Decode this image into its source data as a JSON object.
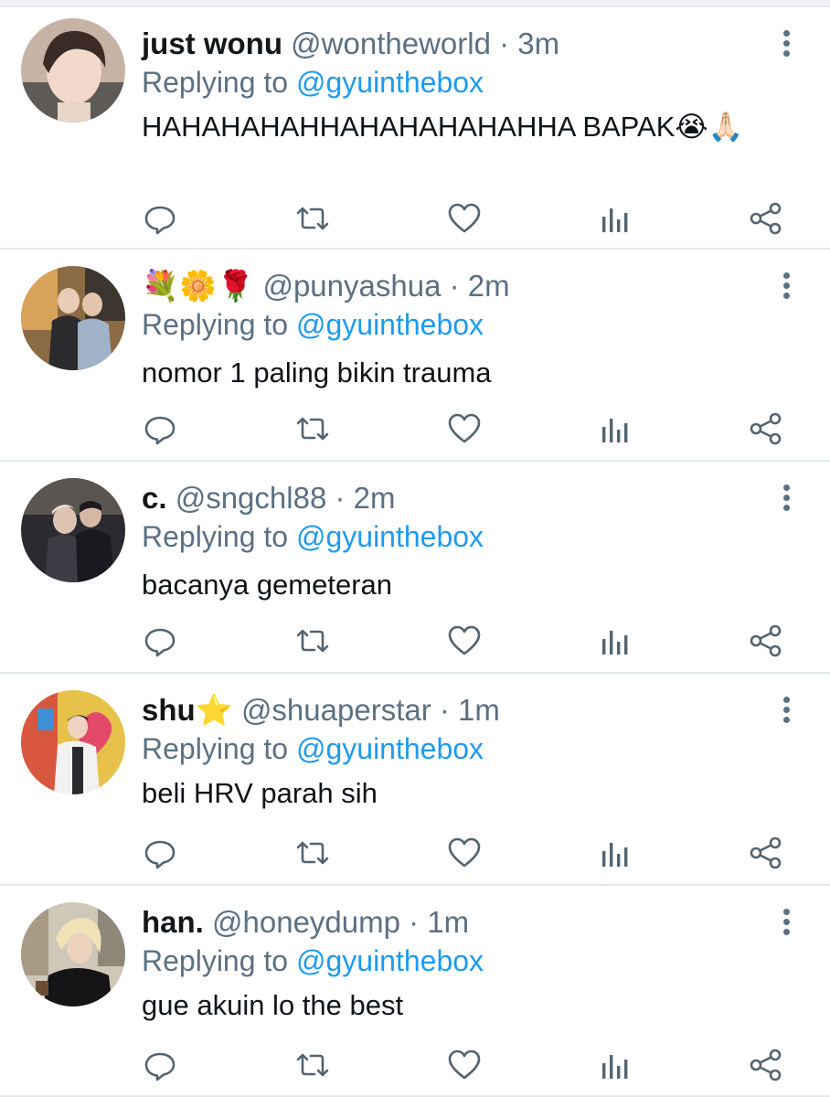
{
  "replying_prefix": "Replying to ",
  "tweets": [
    {
      "name": "just wonu",
      "handle": "@wontheworld",
      "time": "3m",
      "reply_to": "@gyuinthebox",
      "text": "HAHAHAHAHHAHAHAHAHAHHA BAPAK😭🙏🏻"
    },
    {
      "name": "💐🌼🌹",
      "handle": "@punyashua",
      "time": "2m",
      "reply_to": "@gyuinthebox",
      "text": "nomor 1 paling bikin trauma"
    },
    {
      "name": "c.",
      "handle": "@sngchl88",
      "time": "2m",
      "reply_to": "@gyuinthebox",
      "text": "bacanya gemeteran"
    },
    {
      "name": "shu⭐",
      "handle": "@shuaperstar",
      "time": "1m",
      "reply_to": "@gyuinthebox",
      "text": "beli HRV parah sih"
    },
    {
      "name": "han.",
      "handle": "@honeydump",
      "time": "1m",
      "reply_to": "@gyuinthebox",
      "text": "gue akuin lo the best"
    }
  ],
  "colors": {
    "link": "#1d9bf0",
    "muted": "#5b7083",
    "icon": "#536471",
    "divider": "#e3e8ec"
  },
  "icons": [
    "reply-icon",
    "retweet-icon",
    "like-icon",
    "analytics-icon",
    "share-icon",
    "more-options-icon"
  ]
}
